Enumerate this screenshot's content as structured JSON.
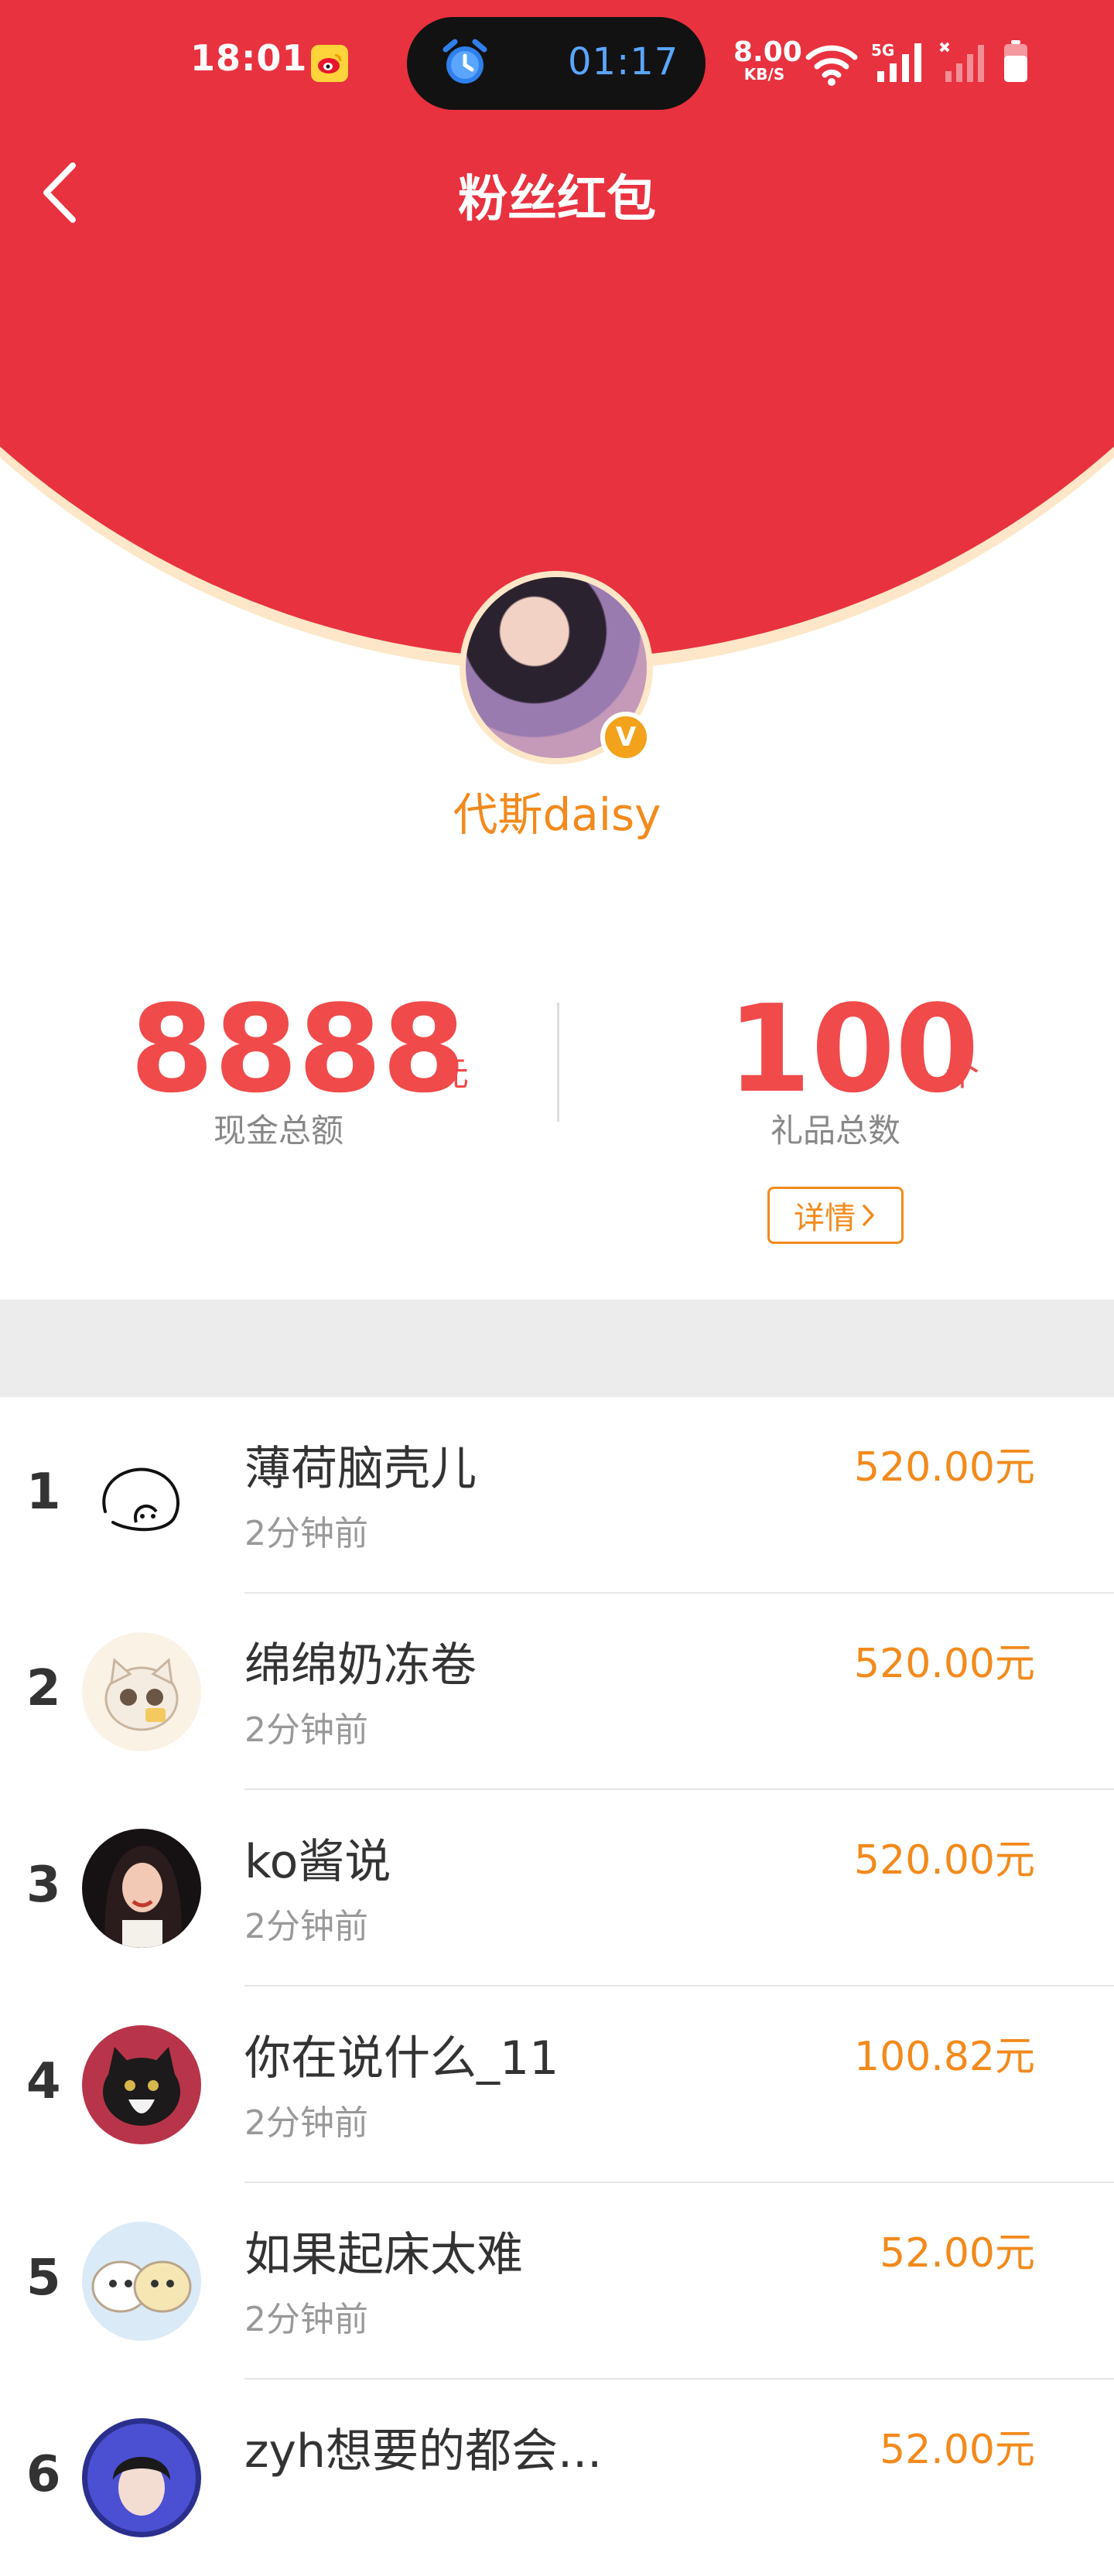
{
  "status_bar": {
    "time": "18:01",
    "timer": "01:17",
    "net_speed": "8.00",
    "net_unit": "KB/S"
  },
  "header": {
    "title": "粉丝红包"
  },
  "profile": {
    "name": "代斯daisy",
    "verified_badge": "V"
  },
  "stats": {
    "cash_total": "8888",
    "cash_unit": "元",
    "cash_label": "现金总额",
    "gift_total": "100",
    "gift_unit": "个",
    "gift_label": "礼品总数",
    "detail_button": "详情"
  },
  "colors": {
    "header_red": "#e8323f",
    "accent_orange": "#f28a1c",
    "stat_red": "#f04a4a"
  },
  "leaderboard": [
    {
      "rank": "1",
      "name": "薄荷脑壳儿",
      "time": "2分钟前",
      "amount": "520.00元"
    },
    {
      "rank": "2",
      "name": "绵绵奶冻卷",
      "time": "2分钟前",
      "amount": "520.00元"
    },
    {
      "rank": "3",
      "name": "ko酱说",
      "time": "2分钟前",
      "amount": "520.00元"
    },
    {
      "rank": "4",
      "name": "你在说什么_11",
      "time": "2分钟前",
      "amount": "100.82元"
    },
    {
      "rank": "5",
      "name": "如果起床太难",
      "time": "2分钟前",
      "amount": "52.00元"
    },
    {
      "rank": "6",
      "name": "zyh想要的都会...",
      "time": "",
      "amount": "52.00元"
    }
  ]
}
